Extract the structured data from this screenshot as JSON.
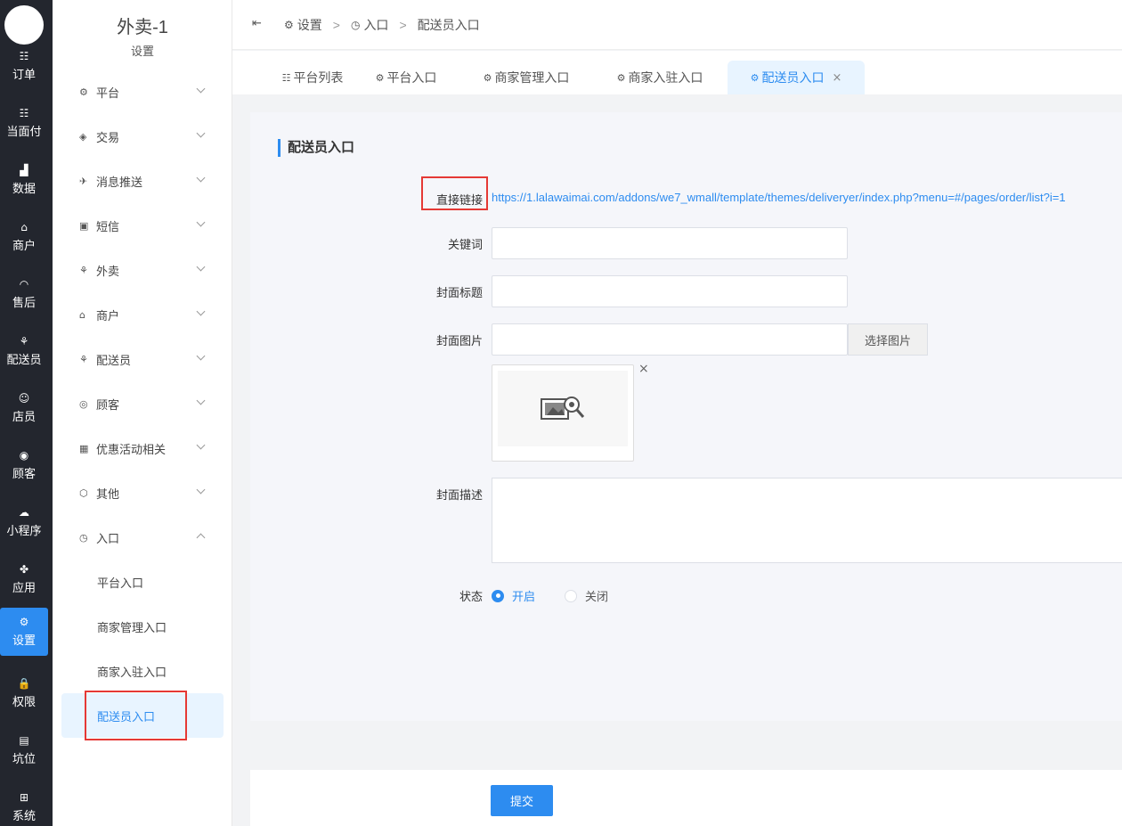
{
  "rail": {
    "items": [
      {
        "label": "订单",
        "icon": "list-icon",
        "glyph": "☷"
      },
      {
        "label": "当面付",
        "icon": "list-icon",
        "glyph": "☷"
      },
      {
        "label": "数据",
        "icon": "bar-chart-icon",
        "glyph": "▟"
      },
      {
        "label": "商户",
        "icon": "store-icon",
        "glyph": "⌂"
      },
      {
        "label": "售后",
        "icon": "headset-icon",
        "glyph": "◠"
      },
      {
        "label": "配送员",
        "icon": "scooter-icon",
        "glyph": "⚘"
      },
      {
        "label": "店员",
        "icon": "users-icon",
        "glyph": "☺"
      },
      {
        "label": "顾客",
        "icon": "user-circle-icon",
        "glyph": "◉"
      },
      {
        "label": "小程序",
        "icon": "wechat-icon",
        "glyph": "☁"
      },
      {
        "label": "应用",
        "icon": "apps-icon",
        "glyph": "✤"
      },
      {
        "label": "设置",
        "icon": "user-settings-icon",
        "glyph": "⚙"
      },
      {
        "label": "权限",
        "icon": "lock-icon",
        "glyph": "🔒"
      },
      {
        "label": "坑位",
        "icon": "document-chart-icon",
        "glyph": "▤"
      },
      {
        "label": "系统",
        "icon": "windows-icon",
        "glyph": "⊞"
      }
    ],
    "active_index": 10,
    "accent": "#2d8cf0"
  },
  "sidebar": {
    "store_name": "外卖-1",
    "section": "设置",
    "menus": [
      {
        "label": "平台",
        "icon": "gear-icon",
        "glyph": "⚙"
      },
      {
        "label": "交易",
        "icon": "wallet-icon",
        "glyph": "◈"
      },
      {
        "label": "消息推送",
        "icon": "send-icon",
        "glyph": "✈"
      },
      {
        "label": "短信",
        "icon": "chat-icon",
        "glyph": "▣"
      },
      {
        "label": "外卖",
        "icon": "scooter-icon",
        "glyph": "⚘"
      },
      {
        "label": "商户",
        "icon": "store-icon",
        "glyph": "⌂"
      },
      {
        "label": "配送员",
        "icon": "scooter-icon",
        "glyph": "⚘"
      },
      {
        "label": "顾客",
        "icon": "user-circle-icon",
        "glyph": "◎"
      },
      {
        "label": "优惠活动相关",
        "icon": "gift-icon",
        "glyph": "▦"
      },
      {
        "label": "其他",
        "icon": "hexagon-icon",
        "glyph": "⬡"
      },
      {
        "label": "入口",
        "icon": "compass-icon",
        "glyph": "◷"
      }
    ],
    "entry_subitems": [
      "平台入口",
      "商家管理入口",
      "商家入驻入口",
      "配送员入口"
    ],
    "active_subitem": "配送员入口"
  },
  "breadcrumb": {
    "items": [
      "设置",
      "入口",
      "配送员入口"
    ],
    "separator": ">"
  },
  "tabs": [
    {
      "label": "平台列表",
      "icon": "list-icon"
    },
    {
      "label": "平台入口",
      "icon": "user-settings-icon"
    },
    {
      "label": "商家管理入口",
      "icon": "user-settings-icon"
    },
    {
      "label": "商家入驻入口",
      "icon": "user-settings-icon"
    },
    {
      "label": "配送员入口",
      "icon": "user-settings-icon",
      "active": true,
      "close": "×"
    }
  ],
  "form": {
    "title": "配送员入口",
    "direct_link_label": "直接链接",
    "direct_link": "https://1.lalawaimai.com/addons/we7_wmall/template/themes/deliveryer/index.php?menu=#/pages/order/list?i=1",
    "keyword_label": "关键词",
    "keyword_value": "",
    "cover_title_label": "封面标题",
    "cover_title_value": "",
    "cover_image_label": "封面图片",
    "cover_image_value": "",
    "pick_image_button": "选择图片",
    "remove_image": "×",
    "cover_desc_label": "封面描述",
    "cover_desc_value": "",
    "status_label": "状态",
    "status_on": "开启",
    "status_off": "关闭",
    "status_selected": "开启"
  },
  "footer": {
    "submit": "提交"
  },
  "colors": {
    "accent": "#2d8cf0",
    "rail_bg": "#23262e",
    "highlight": "#e53935"
  }
}
